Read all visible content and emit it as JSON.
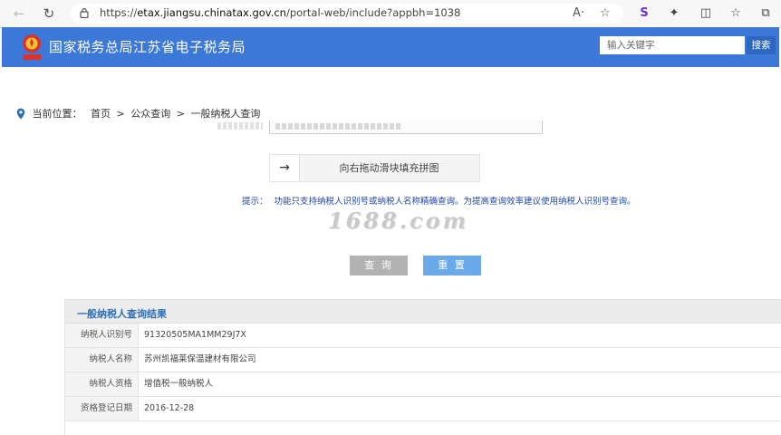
{
  "browser": {
    "url_prefix": "https://",
    "url_host": "etax.jiangsu.chinatax.gov.cn",
    "url_path": "/portal-web/include?appbh=1038",
    "read_aloud_icon": "A·"
  },
  "header": {
    "title": "国家税务总局江苏省电子税务局",
    "search_placeholder": "输入关键字",
    "search_button": "搜索"
  },
  "breadcrumb": {
    "prefix": "当前位置：",
    "items": [
      "首页",
      "公众查询",
      "一般纳税人查询"
    ],
    "separator": ">"
  },
  "form": {
    "slider_text": "向右拖动滑块填充拼图",
    "slider_arrow": "→",
    "hint_label": "提示：",
    "hint_text": "功能只支持纳税人识别号或纳税人名称精确查询。为提高查询效率建议使用纳税人识别号查询。",
    "watermark": "1688.com",
    "query_button": "查 询",
    "reset_button": "重 置"
  },
  "results": {
    "title": "一般纳税人查询结果",
    "rows": [
      {
        "label": "纳税人识别号",
        "value": "91320505MA1MM29J7X"
      },
      {
        "label": "纳税人名称",
        "value": "苏州凯福莱保温建材有限公司"
      },
      {
        "label": "纳税人资格",
        "value": "增值税一般纳税人"
      },
      {
        "label": "资格登记日期",
        "value": "2016-12-28"
      }
    ]
  },
  "colors": {
    "header_bg": "#3b78d8",
    "search_btn": "#2e67c2",
    "reset_btn": "#6aa9ea",
    "query_btn": "#b2b2b2",
    "results_title": "#2f6fb7",
    "hint": "#2247a8"
  }
}
